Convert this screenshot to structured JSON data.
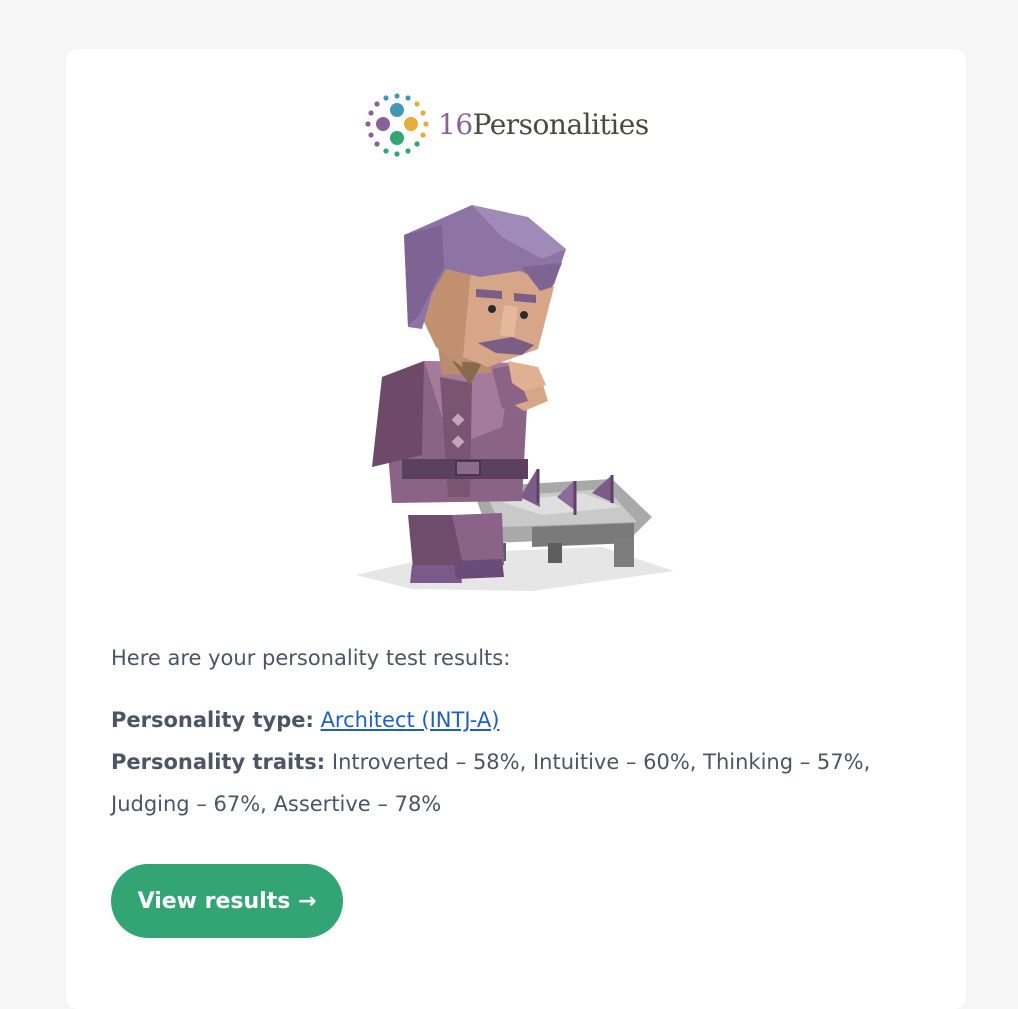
{
  "brand": {
    "number": "16",
    "word": "Personalities",
    "colors": {
      "purple": "#88619a",
      "blue": "#4298b4",
      "yellow": "#e4ae3a",
      "green": "#33a474",
      "text": "#4a4a42"
    }
  },
  "illustration": {
    "icon": "architect-character-illustration"
  },
  "message": {
    "intro": "Here are your personality test results:",
    "type_label": "Personality type:",
    "type_value": "Architect (INTJ-A)",
    "traits_label": "Personality traits:",
    "traits_value": "Introverted – 58%, Intuitive – 60%, Thinking – 57%, Judging – 67%, Assertive – 78%"
  },
  "cta": {
    "label": "View results →",
    "color": "#33a474"
  }
}
